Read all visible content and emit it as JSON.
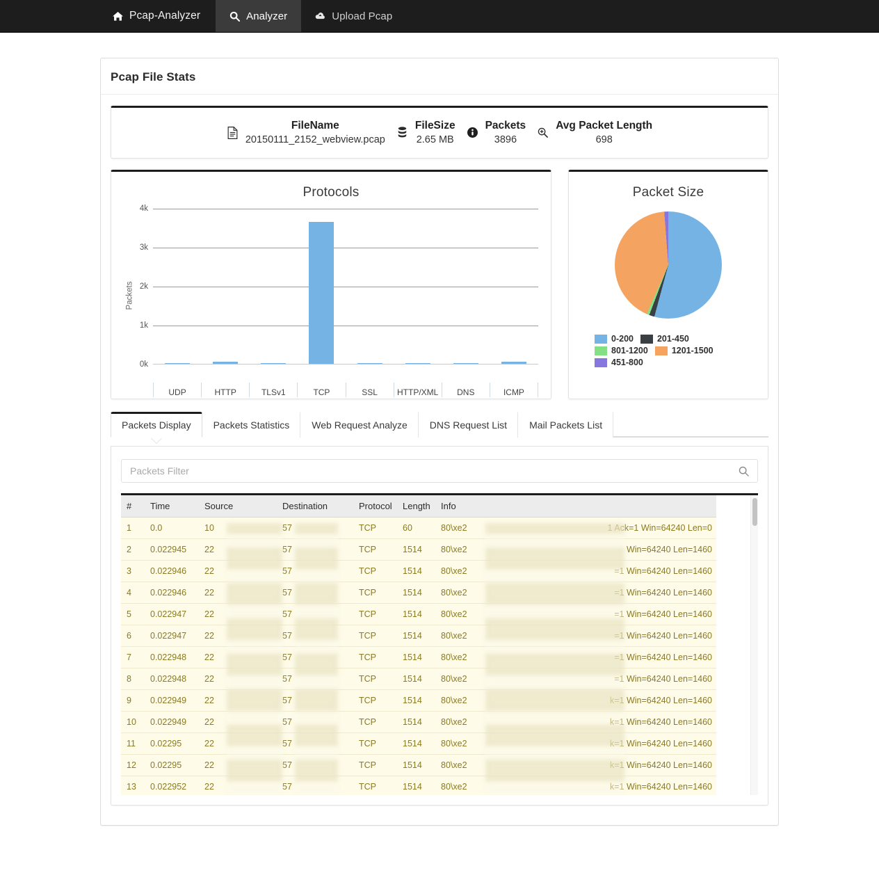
{
  "navbar": {
    "items": [
      {
        "label": "Pcap-Analyzer",
        "icon": "home-icon",
        "active": false
      },
      {
        "label": "Analyzer",
        "icon": "search-icon",
        "active": true
      },
      {
        "label": "Upload Pcap",
        "icon": "cloud-upload-icon",
        "active": false
      }
    ]
  },
  "panel": {
    "title": "Pcap File Stats"
  },
  "file_stats": [
    {
      "icon": "file-text-icon",
      "label": "FileName",
      "value": "20150111_2152_webview.pcap"
    },
    {
      "icon": "database-icon",
      "label": "FileSize",
      "value": "2.65 MB"
    },
    {
      "icon": "info-circle-icon",
      "label": "Packets",
      "value": "3896"
    },
    {
      "icon": "search-plus-icon",
      "label": "Avg Packet Length",
      "value": "698"
    }
  ],
  "chart_data": [
    {
      "type": "bar",
      "title": "Protocols",
      "xlabel": "",
      "ylabel": "Packets",
      "categories": [
        "UDP",
        "HTTP",
        "TLSv1",
        "TCP",
        "SSL",
        "HTTP/XML",
        "DNS",
        "ICMP"
      ],
      "values": [
        2,
        55,
        14,
        3640,
        1,
        1,
        24,
        46
      ],
      "ylim": [
        0,
        4000
      ],
      "yticks": [
        "0k",
        "1k",
        "2k",
        "3k",
        "4k"
      ],
      "ytick_values": [
        0,
        1000,
        2000,
        3000,
        4000
      ],
      "grid": true,
      "bar_color": "#74b3e4",
      "legend": "none"
    },
    {
      "type": "pie",
      "title": "Packet Size",
      "legend_position": "bottom",
      "slices": [
        {
          "label": "0-200",
          "value": 54.2,
          "color": "#74b3e4"
        },
        {
          "label": "201-450",
          "value": 1.6,
          "color": "#3a3f44"
        },
        {
          "label": "801-1200",
          "value": 0.8,
          "color": "#85e085"
        },
        {
          "label": "1201-1500",
          "value": 42.2,
          "color": "#f4a460"
        },
        {
          "label": "451-800",
          "value": 1.2,
          "color": "#8577dd"
        }
      ],
      "legend_order": [
        "0-200",
        "201-450",
        "801-1200",
        "1201-1500",
        "451-800"
      ]
    }
  ],
  "tabs": [
    {
      "label": "Packets Display",
      "active": true
    },
    {
      "label": "Packets Statistics",
      "active": false
    },
    {
      "label": "Web Request Analyze",
      "active": false
    },
    {
      "label": "DNS Request List",
      "active": false
    },
    {
      "label": "Mail Packets List",
      "active": false
    }
  ],
  "filter": {
    "placeholder": "Packets Filter",
    "value": "",
    "icon": "search-icon"
  },
  "packets_table": {
    "columns": [
      "#",
      "Time",
      "Source",
      "Destination",
      "Protocol",
      "Length",
      "Info"
    ],
    "rows": [
      {
        "num": "1",
        "time": "0.0",
        "source": "10",
        "destination": "57",
        "protocol": "TCP",
        "length": "60",
        "info": "80\\xe2",
        "info_tail": "1 Ack=1 Win=64240 Len=0"
      },
      {
        "num": "2",
        "time": "0.022945",
        "source": "22",
        "destination": "57",
        "protocol": "TCP",
        "length": "1514",
        "info": "80\\xe2",
        "info_tail": "Win=64240 Len=1460"
      },
      {
        "num": "3",
        "time": "0.022946",
        "source": "22",
        "destination": "57",
        "protocol": "TCP",
        "length": "1514",
        "info": "80\\xe2",
        "info_tail": "=1 Win=64240 Len=1460"
      },
      {
        "num": "4",
        "time": "0.022946",
        "source": "22",
        "destination": "57",
        "protocol": "TCP",
        "length": "1514",
        "info": "80\\xe2",
        "info_tail": "=1 Win=64240 Len=1460"
      },
      {
        "num": "5",
        "time": "0.022947",
        "source": "22",
        "destination": "57",
        "protocol": "TCP",
        "length": "1514",
        "info": "80\\xe2",
        "info_tail": "=1 Win=64240 Len=1460"
      },
      {
        "num": "6",
        "time": "0.022947",
        "source": "22",
        "destination": "57",
        "protocol": "TCP",
        "length": "1514",
        "info": "80\\xe2",
        "info_tail": "=1 Win=64240 Len=1460"
      },
      {
        "num": "7",
        "time": "0.022948",
        "source": "22",
        "destination": "57",
        "protocol": "TCP",
        "length": "1514",
        "info": "80\\xe2",
        "info_tail": "=1 Win=64240 Len=1460"
      },
      {
        "num": "8",
        "time": "0.022948",
        "source": "22",
        "destination": "57",
        "protocol": "TCP",
        "length": "1514",
        "info": "80\\xe2",
        "info_tail": "=1 Win=64240 Len=1460"
      },
      {
        "num": "9",
        "time": "0.022949",
        "source": "22",
        "destination": "57",
        "protocol": "TCP",
        "length": "1514",
        "info": "80\\xe2",
        "info_tail": "k=1 Win=64240 Len=1460"
      },
      {
        "num": "10",
        "time": "0.022949",
        "source": "22",
        "destination": "57",
        "protocol": "TCP",
        "length": "1514",
        "info": "80\\xe2",
        "info_tail": "k=1 Win=64240 Len=1460"
      },
      {
        "num": "11",
        "time": "0.02295",
        "source": "22",
        "destination": "57",
        "protocol": "TCP",
        "length": "1514",
        "info": "80\\xe2",
        "info_tail": "k=1 Win=64240 Len=1460"
      },
      {
        "num": "12",
        "time": "0.02295",
        "source": "22",
        "destination": "57",
        "protocol": "TCP",
        "length": "1514",
        "info": "80\\xe2",
        "info_tail": "k=1 Win=64240 Len=1460"
      },
      {
        "num": "13",
        "time": "0.022952",
        "source": "22",
        "destination": "57",
        "protocol": "TCP",
        "length": "1514",
        "info": "80\\xe2",
        "info_tail": "k=1 Win=64240 Len=1460"
      }
    ]
  },
  "colors": {
    "page_bg": "#ffffff",
    "navbar_bg": "#1d1d1d",
    "navbar_active_bg": "#3b3b3b",
    "accent_bar": "#74b3e4",
    "table_row_bg": "#fefbe9",
    "table_text": "#8a7a22"
  }
}
